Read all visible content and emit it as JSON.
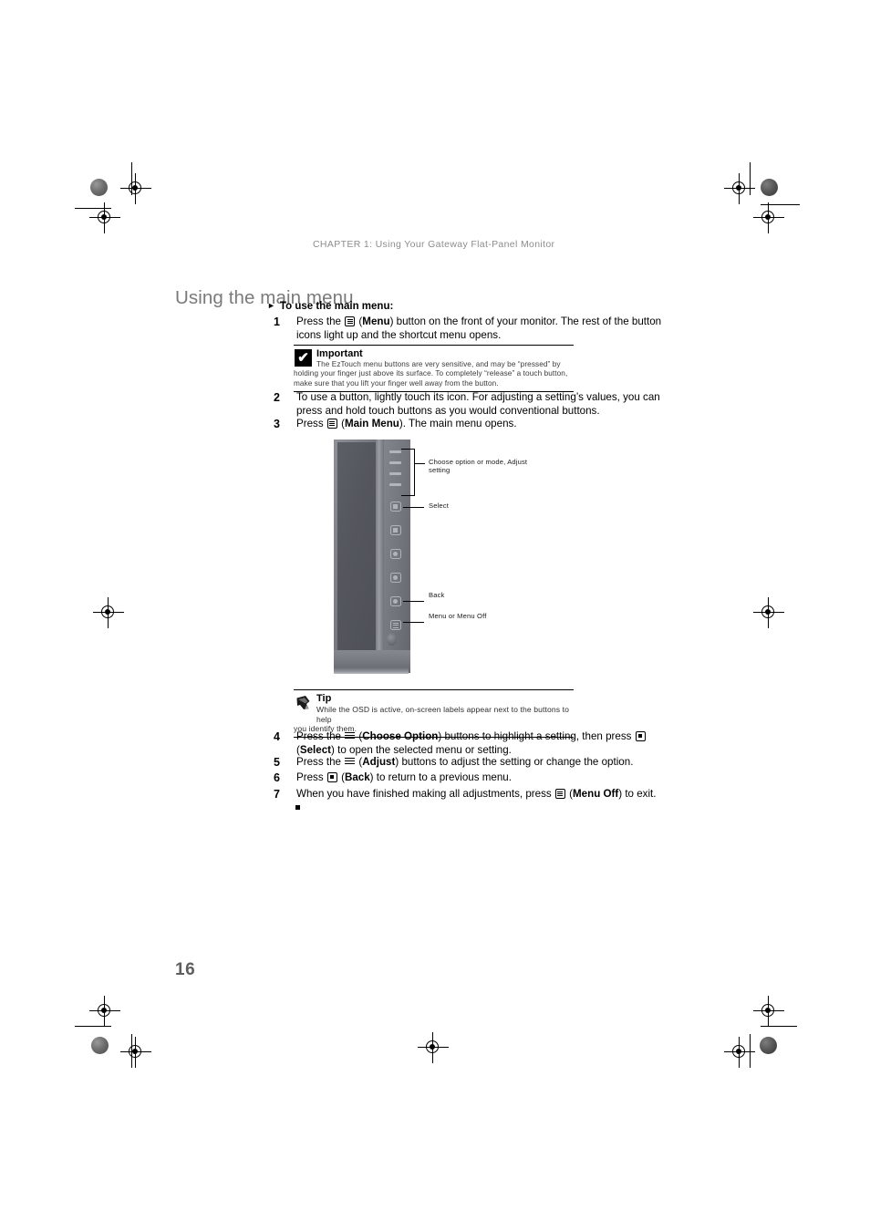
{
  "document": {
    "running_head": "CHAPTER 1: Using Your Gateway Flat-Panel Monitor",
    "page_title": "Using the main menu",
    "folio": "16"
  },
  "procedure": {
    "heading": "To use the main menu:",
    "steps": [
      {
        "number": "1",
        "text_parts": [
          {
            "t": "Press the "
          },
          {
            "icon": "menu-icon"
          },
          {
            "t": " ("
          },
          {
            "b": "Menu"
          },
          {
            "t": ") button on the front of your monitor. The rest of the button icons light up and the shortcut menu opens."
          }
        ]
      },
      {
        "number": "2",
        "text_parts": [
          {
            "t": "To use a button, lightly touch its icon. For adjusting a setting’s values, you can press and hold touch buttons as you would conventional buttons."
          }
        ]
      },
      {
        "number": "3",
        "text_parts": [
          {
            "t": "Press "
          },
          {
            "icon": "menu-icon"
          },
          {
            "t": " ("
          },
          {
            "b": "Main Menu"
          },
          {
            "t": "). The main menu opens."
          }
        ]
      },
      {
        "number": "4",
        "text_parts": [
          {
            "t": "Press the "
          },
          {
            "icon": "adjust-bars-icon"
          },
          {
            "t": " ("
          },
          {
            "b": "Choose Option"
          },
          {
            "t": ") buttons to highlight a setting, then press "
          },
          {
            "icon": "select-icon"
          },
          {
            "t": " ("
          },
          {
            "b": "Select"
          },
          {
            "t": ") to open the selected menu or setting."
          }
        ]
      },
      {
        "number": "5",
        "text_parts": [
          {
            "t": "Press the "
          },
          {
            "icon": "adjust-bars-icon"
          },
          {
            "t": " ("
          },
          {
            "b": "Adjust"
          },
          {
            "t": ") buttons to adjust the setting or change the option."
          }
        ]
      },
      {
        "number": "6",
        "text_parts": [
          {
            "t": "Press "
          },
          {
            "icon": "select-icon"
          },
          {
            "t": " ("
          },
          {
            "b": "Back"
          },
          {
            "t": ") to return to a previous menu."
          }
        ]
      },
      {
        "number": "7",
        "text_parts": [
          {
            "t": "When you have finished making all adjustments, press "
          },
          {
            "icon": "menu-icon"
          },
          {
            "t": " ("
          },
          {
            "b": "Menu Off"
          },
          {
            "t": ") to exit."
          }
        ]
      }
    ]
  },
  "important_note": {
    "icon": "checkmark-icon",
    "title": "Important",
    "line1": "The EzTouch menu buttons are very sensitive, and may be “pressed” by",
    "line2": "holding your finger just above its surface. To completely “release” a touch button,",
    "line3": "make sure that you lift your finger well away from the button."
  },
  "tip_note": {
    "icon": "pointing-hand-icon",
    "title": "Tip",
    "line1": "While the OSD is active, on-screen labels appear next to the buttons to help",
    "line2": "you identify them."
  },
  "figure": {
    "alt_name": "monitor-front-panel-photo",
    "callouts": [
      {
        "label": "Choose option or mode, Adjust\nsetting"
      },
      {
        "label": "Select"
      },
      {
        "label": "Back"
      },
      {
        "label": "Menu or Menu Off"
      }
    ]
  },
  "colors": {
    "running_head": "#8d8d8d",
    "page_title": "#7a7a7a",
    "folio": "#5e5e5e",
    "body_text": "#000000"
  }
}
